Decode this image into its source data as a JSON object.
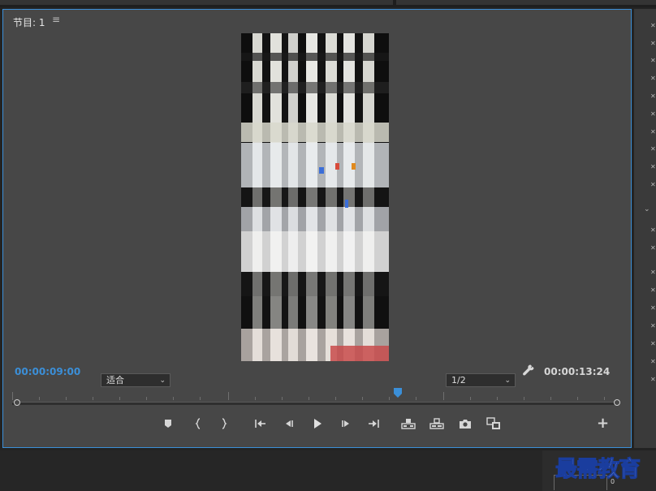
{
  "panel": {
    "title": "节目: 1",
    "menu_icon": "hamburger-menu-icon"
  },
  "playback": {
    "current_timecode": "00:00:09:00",
    "duration_timecode": "00:00:13:24",
    "zoom_value": "适合",
    "resolution_value": "1/2",
    "playhead_position_fraction": 0.64
  },
  "transport": {
    "buttons": [
      "marker-icon",
      "mark-in-icon",
      "mark-out-icon",
      "go-to-in-icon",
      "step-back-icon",
      "play-icon",
      "step-forward-icon",
      "go-to-out-icon",
      "lift-icon",
      "extract-icon",
      "export-frame-icon",
      "compare-icon"
    ],
    "add_button_icon": "plus-icon"
  },
  "watermark": {
    "text": "最需教育"
  },
  "bottom": {
    "value": "0"
  },
  "colors": {
    "panel_bg": "#474747",
    "accent_blue": "#3b8fd8",
    "app_bg": "#232323"
  }
}
